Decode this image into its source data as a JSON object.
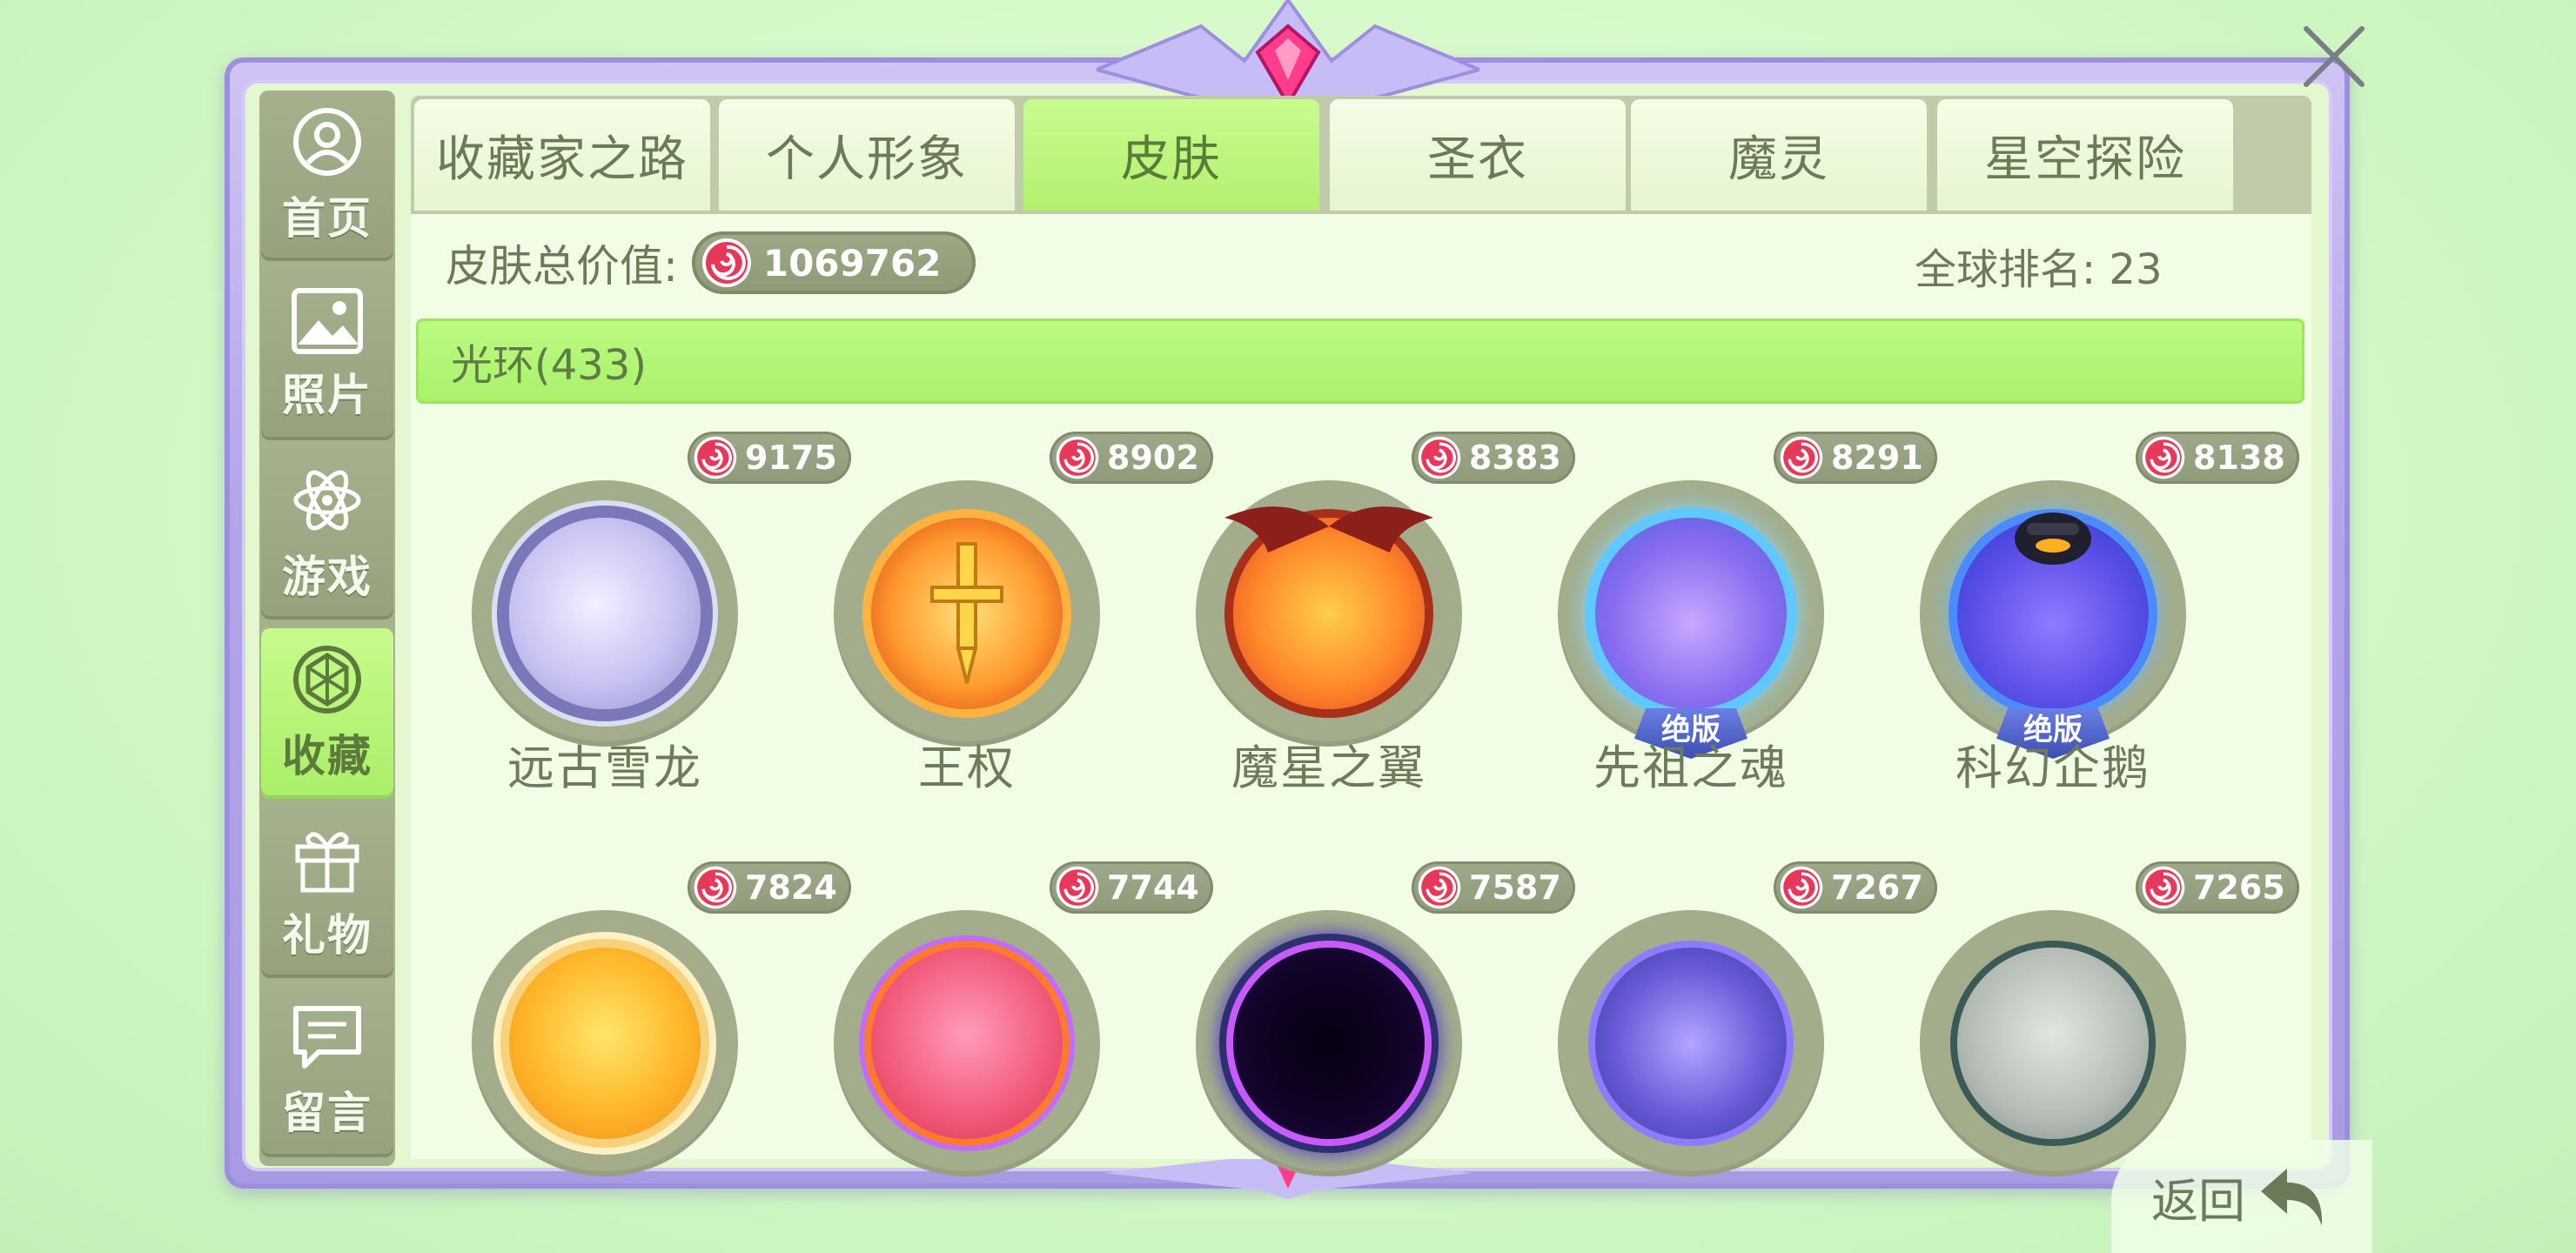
{
  "sidebar": {
    "items": [
      {
        "label": "首页",
        "icon": "home-icon"
      },
      {
        "label": "照片",
        "icon": "photo-icon"
      },
      {
        "label": "游戏",
        "icon": "atom-icon"
      },
      {
        "label": "收藏",
        "icon": "collection-icon",
        "active": true
      },
      {
        "label": "礼物",
        "icon": "gift-icon"
      },
      {
        "label": "留言",
        "icon": "message-icon"
      }
    ]
  },
  "tabs": [
    {
      "label": "收藏家之路"
    },
    {
      "label": "个人形象"
    },
    {
      "label": "皮肤",
      "active": true
    },
    {
      "label": "圣衣"
    },
    {
      "label": "魔灵"
    },
    {
      "label": "星空探险"
    }
  ],
  "summary": {
    "value_label": "皮肤总价值:",
    "value": "1069762",
    "rank": "全球排名: 23"
  },
  "section": {
    "label": "光环(433)"
  },
  "items": [
    {
      "name": "远古雪龙",
      "price": "9175"
    },
    {
      "name": "王权",
      "price": "8902"
    },
    {
      "name": "魔星之翼",
      "price": "8383"
    },
    {
      "name": "先祖之魂",
      "price": "8291",
      "badge": "绝版"
    },
    {
      "name": "科幻企鹅",
      "price": "8138",
      "badge": "绝版"
    },
    {
      "name": "",
      "price": "7824"
    },
    {
      "name": "",
      "price": "7744"
    },
    {
      "name": "",
      "price": "7587"
    },
    {
      "name": "",
      "price": "7267"
    },
    {
      "name": "",
      "price": "7265"
    }
  ],
  "back": {
    "label": "返回"
  },
  "colors": {
    "accent": "#b3f170",
    "sidebar": "#a5b08c",
    "frame": "#b3a5ea",
    "coin": "#e8385a"
  }
}
